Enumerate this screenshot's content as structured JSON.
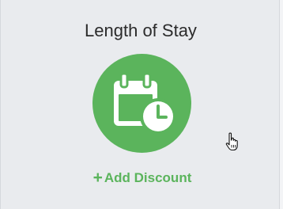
{
  "card": {
    "title": "Length of Stay",
    "icon": "calendar-clock-icon",
    "action_icon": "plus-icon",
    "action_plus": "+",
    "action_label": "Add Discount"
  },
  "colors": {
    "accent": "#5bb45c",
    "card_bg": "#e9ebee",
    "title_text": "#2b2b2b"
  },
  "cursor": "hand-pointer-icon"
}
